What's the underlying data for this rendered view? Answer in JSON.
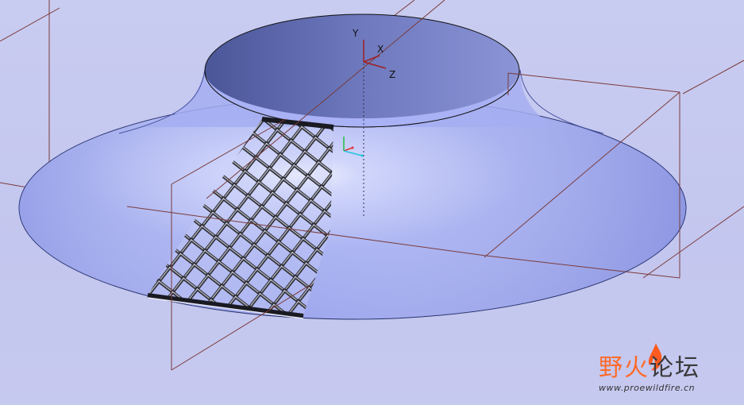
{
  "viewport": {
    "background": "#c5c8ee",
    "surface_color": "#a7b1f3",
    "plane_color": "#7a3b3b",
    "lattice_color": "#2b2b33"
  },
  "csys": {
    "x_label": "X",
    "y_label": "Y",
    "z_label": "Z"
  },
  "watermark": {
    "title_part1": "野",
    "title_part2": "火",
    "title_part3": "论坛",
    "url": "www.proewildfire.cn"
  }
}
